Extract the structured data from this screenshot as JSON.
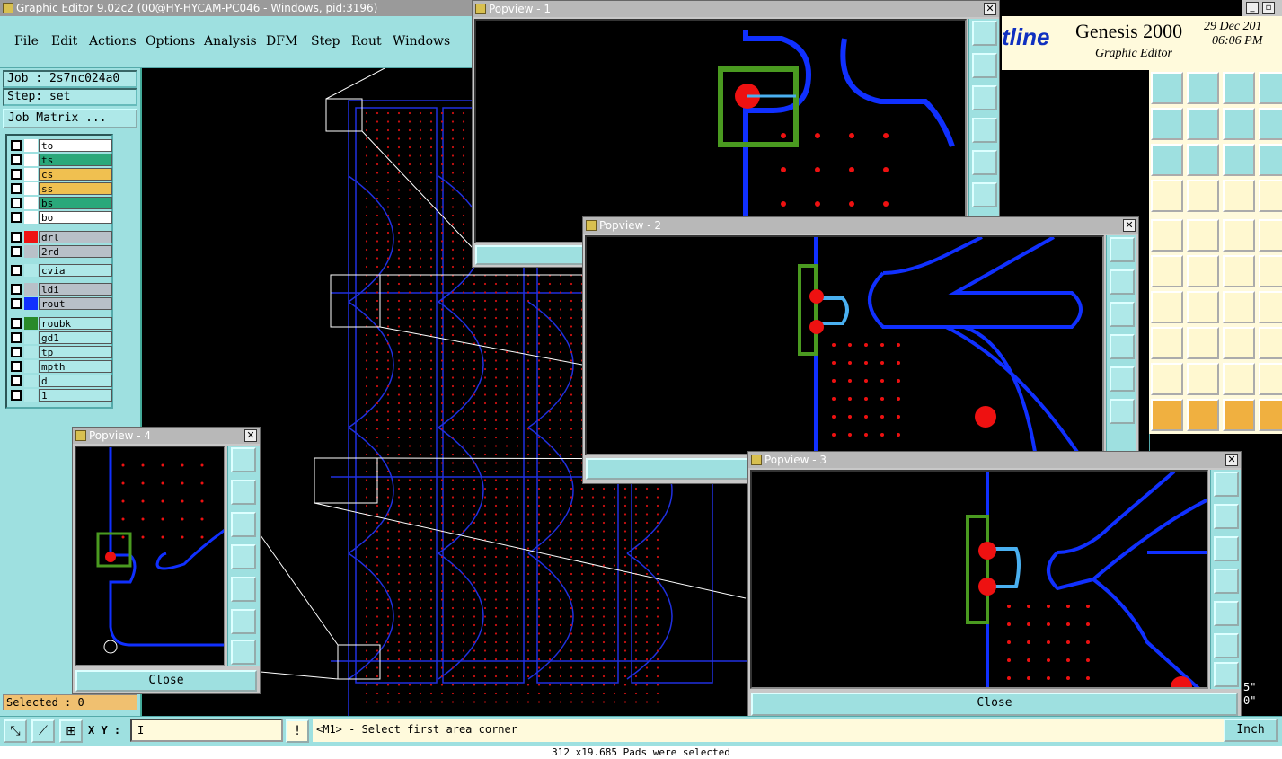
{
  "window": {
    "title": "Graphic Editor 9.02c2 (00@HY-HYCAM-PC046 - Windows, pid:3196)"
  },
  "menu": [
    "File",
    "Edit",
    "Actions",
    "Options",
    "Analysis",
    "DFM",
    "Step",
    "Rout",
    "Windows"
  ],
  "job": {
    "job_label": "Job : 2s7nc024a0",
    "step_label": "Step: set",
    "matrix_button": "Job Matrix ..."
  },
  "layers": [
    {
      "name": "to",
      "color": "#ffffff",
      "swatch": "#ffffff"
    },
    {
      "name": "ts",
      "color": "#2aa87a",
      "swatch": "#ffffff"
    },
    {
      "name": "cs",
      "color": "#f0c050",
      "swatch": "#ffffff"
    },
    {
      "name": "ss",
      "color": "#f0c050",
      "swatch": "#ffffff"
    },
    {
      "name": "bs",
      "color": "#2aa87a",
      "swatch": "#ffffff"
    },
    {
      "name": "bo",
      "color": "#ffffff",
      "swatch": "#ffffff"
    },
    {
      "name": "drl",
      "color": "#b8c0c8",
      "swatch": "#ee1111"
    },
    {
      "name": "2rd",
      "color": "#b8c0c8",
      "swatch": "#b8c0c8"
    },
    {
      "name": "cvia",
      "color": "#aee8e8",
      "swatch": "#aee8e8"
    },
    {
      "name": "ldi",
      "color": "#b8c0c8",
      "swatch": "#b8c0c8"
    },
    {
      "name": "rout",
      "color": "#b8c0c8",
      "swatch": "#1030ff"
    },
    {
      "name": "roubk",
      "color": "#aee8e8",
      "swatch": "#2a8a2a"
    },
    {
      "name": "gd1",
      "color": "#aee8e8",
      "swatch": "#aee8e8"
    },
    {
      "name": "tp",
      "color": "#aee8e8",
      "swatch": "#aee8e8"
    },
    {
      "name": "mpth",
      "color": "#aee8e8",
      "swatch": "#aee8e8"
    },
    {
      "name": "d",
      "color": "#aee8e8",
      "swatch": "#aee8e8"
    },
    {
      "name": "1",
      "color": "#aee8e8",
      "swatch": "#aee8e8"
    }
  ],
  "selected": "Selected : 0",
  "brand": {
    "logo": "tline",
    "product": "Genesis 2000",
    "subtitle": "Graphic Editor",
    "date": "29 Dec 201",
    "time": "06:06 PM"
  },
  "status": {
    "xy_label": "X Y :",
    "xy_value": "I",
    "prompt": "<M1> - Select first area corner",
    "units": "Inch",
    "bottom": "312 x19.685 Pads were selected"
  },
  "popviews": [
    {
      "id": "p1",
      "title": "Popview - 1"
    },
    {
      "id": "p2",
      "title": "Popview - 2"
    },
    {
      "id": "p3",
      "title": "Popview - 3",
      "close": "Close"
    },
    {
      "id": "p4",
      "title": "Popview - 4",
      "close": "Close"
    }
  ],
  "right_edge_text": [
    "5\"",
    "0\""
  ],
  "colors": {
    "panel": "#9ee0e0",
    "rout": "#1030ff",
    "drill": "#ee1111",
    "roubk": "#4a9a20",
    "highlight": "#4ab0f0"
  }
}
